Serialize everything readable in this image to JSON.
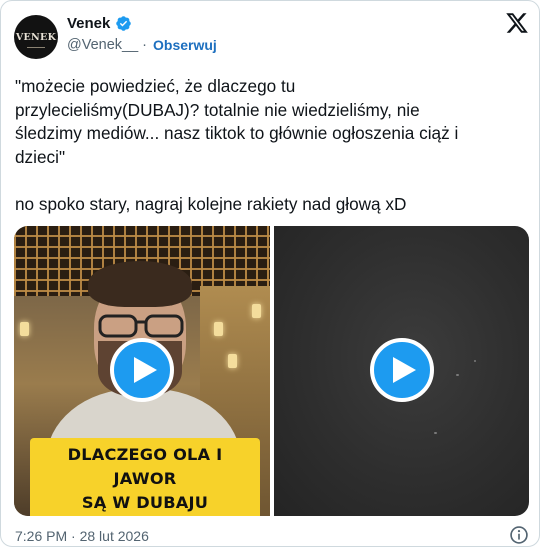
{
  "account": {
    "avatar_text": "VENEK",
    "name": "Venek",
    "handle": "@Venek__",
    "separator": "·",
    "follow_label": "Obserwuj",
    "verified_icon": "verified-badge-icon"
  },
  "platform_icon": "x-logo-icon",
  "tweet": {
    "text": "\"możecie powiedzieć, że dlaczego tu\nprzylecieliśmy(DUBAJ)? totalnie nie wiedzieliśmy, nie\nśledzimy mediów... nasz tiktok to głównie ogłoszenia ciąż i\ndzieci\"\n\nno spoko stary, nagraj kolejne rakiety nad głową xD"
  },
  "media": {
    "video_left": {
      "caption": "DLACZEGO OLA I JAWOR\nSĄ W DUBAJU",
      "play_icon": "play-icon"
    },
    "video_right": {
      "play_icon": "play-icon"
    }
  },
  "footer": {
    "timestamp": "7:26 PM · 28 lut 2026",
    "info_icon": "info-icon"
  },
  "colors": {
    "accent": "#1d9bf0",
    "follow_link": "#1d6fbf",
    "caption_bg": "#f7d22a",
    "muted_text": "#536471"
  }
}
